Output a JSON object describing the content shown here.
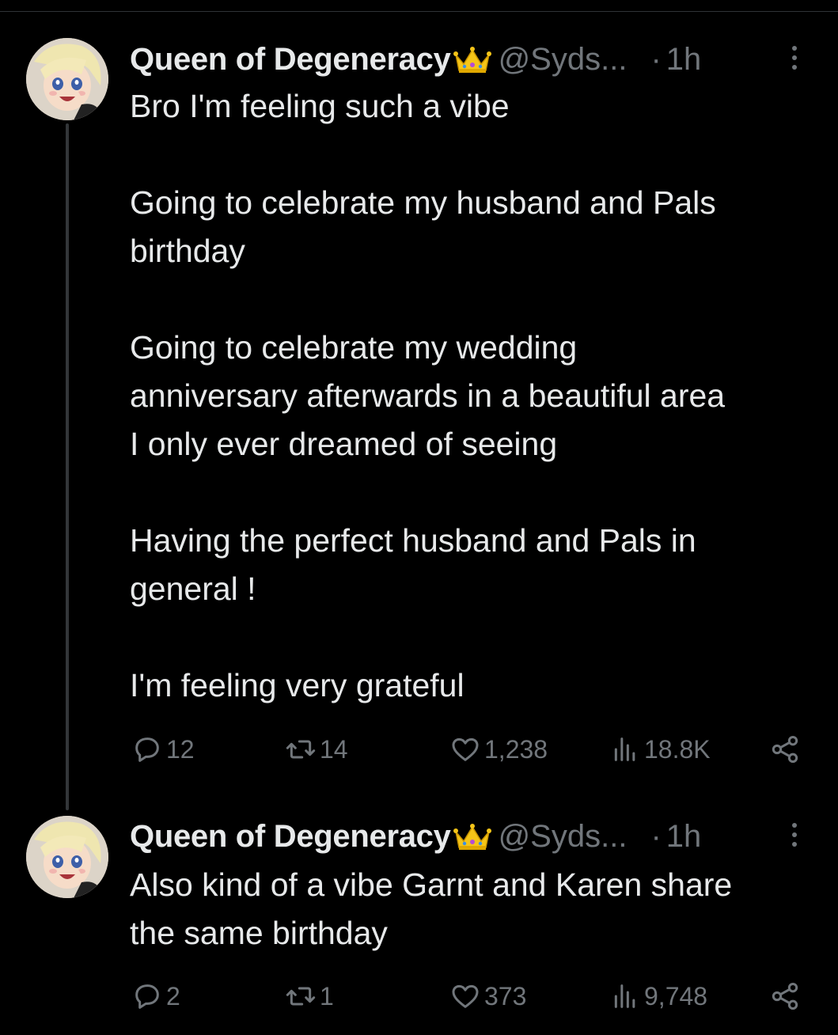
{
  "tweets": [
    {
      "name": "Queen of Degeneracy",
      "handle": "@Syds...",
      "dot": "·",
      "time": "1h",
      "lines": [
        "Bro I'm feeling such a vibe",
        "",
        "Going to celebrate my husband and Pals",
        "birthday",
        "",
        "Going to celebrate my wedding",
        "anniversary afterwards in a beautiful area",
        "I only ever dreamed of seeing",
        "",
        "Having the perfect husband and Pals in",
        "general !",
        "",
        "I'm feeling very grateful"
      ],
      "replies": "12",
      "retweets": "14",
      "likes": "1,238",
      "views": "18.8K"
    },
    {
      "name": "Queen of Degeneracy",
      "handle": "@Syds...",
      "dot": "·",
      "time": "1h",
      "lines": [
        "Also kind of a vibe Garnt and Karen share",
        "the same birthday"
      ],
      "replies": "2",
      "retweets": "1",
      "likes": "373",
      "views": "9,748"
    }
  ],
  "icons": {
    "crown": "crown-emoji",
    "reply": "reply-icon",
    "retweet": "retweet-icon",
    "like": "heart-icon",
    "views": "views-icon",
    "share": "share-icon",
    "more": "more-icon"
  },
  "colors": {
    "background": "#000000",
    "text": "#e7e9ea",
    "secondary": "#71767b",
    "thread_line": "#333639"
  }
}
